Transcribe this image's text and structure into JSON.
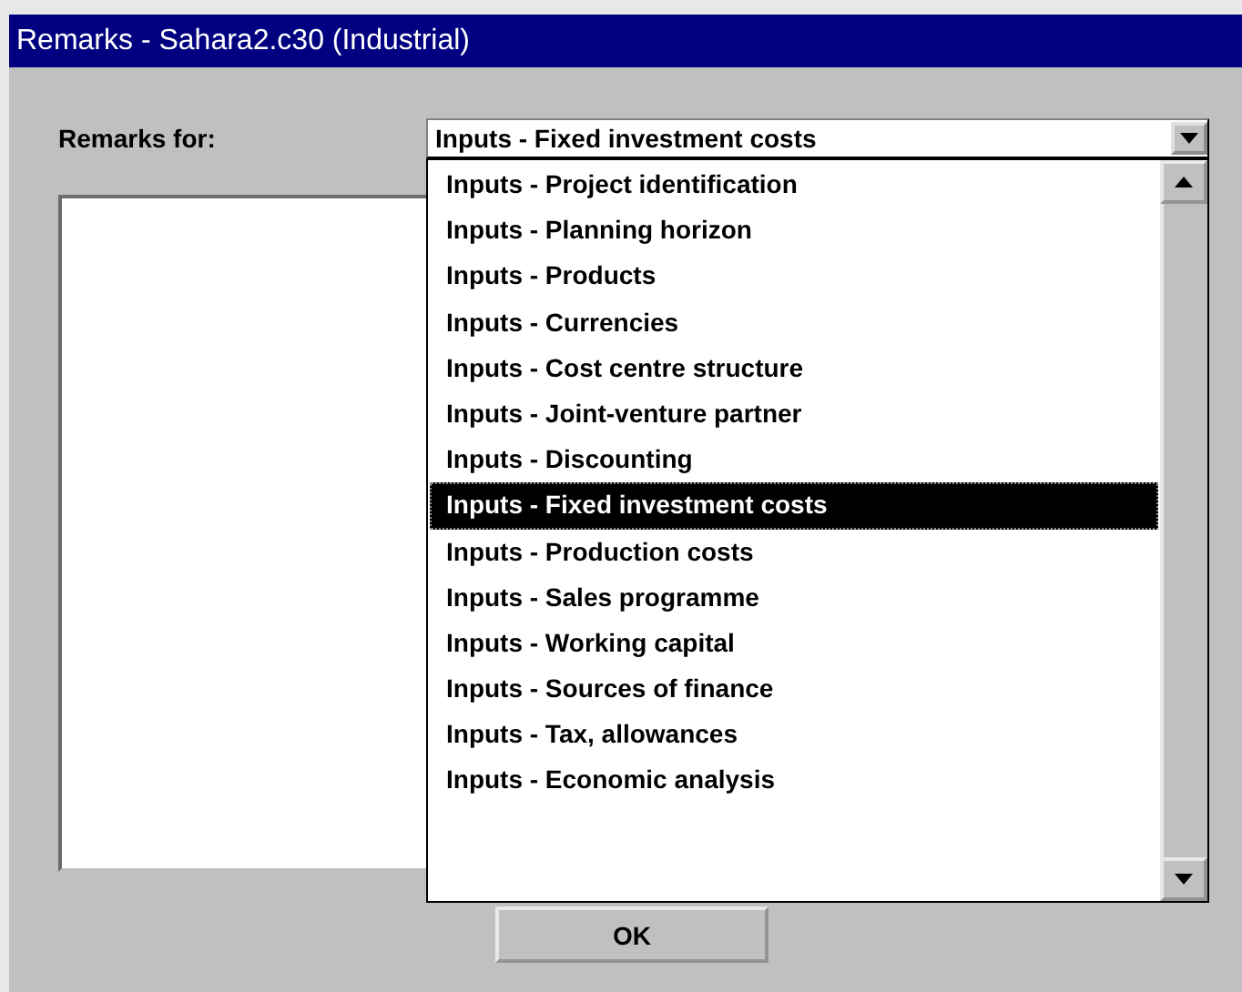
{
  "window": {
    "title": "Remarks - Sahara2.c30 (Industrial)"
  },
  "remarks_for": {
    "label": "Remarks for:",
    "value": "Inputs - Fixed investment costs",
    "expanded": true,
    "options": [
      {
        "label": "Inputs - Project identification",
        "selected": false
      },
      {
        "label": "Inputs - Planning horizon",
        "selected": false
      },
      {
        "label": "Inputs - Products",
        "selected": false
      },
      {
        "label": "Inputs - Currencies",
        "selected": false
      },
      {
        "label": "Inputs - Cost centre structure",
        "selected": false
      },
      {
        "label": "Inputs - Joint-venture partner",
        "selected": false
      },
      {
        "label": "Inputs - Discounting",
        "selected": false
      },
      {
        "label": "Inputs - Fixed investment costs",
        "selected": true
      },
      {
        "label": "Inputs - Production costs",
        "selected": false
      },
      {
        "label": "Inputs - Sales programme",
        "selected": false
      },
      {
        "label": "Inputs - Working capital",
        "selected": false
      },
      {
        "label": "Inputs - Sources of finance",
        "selected": false
      },
      {
        "label": "Inputs - Tax, allowances",
        "selected": false
      },
      {
        "label": "Inputs - Economic analysis",
        "selected": false
      }
    ]
  },
  "buttons": [
    "OK"
  ]
}
